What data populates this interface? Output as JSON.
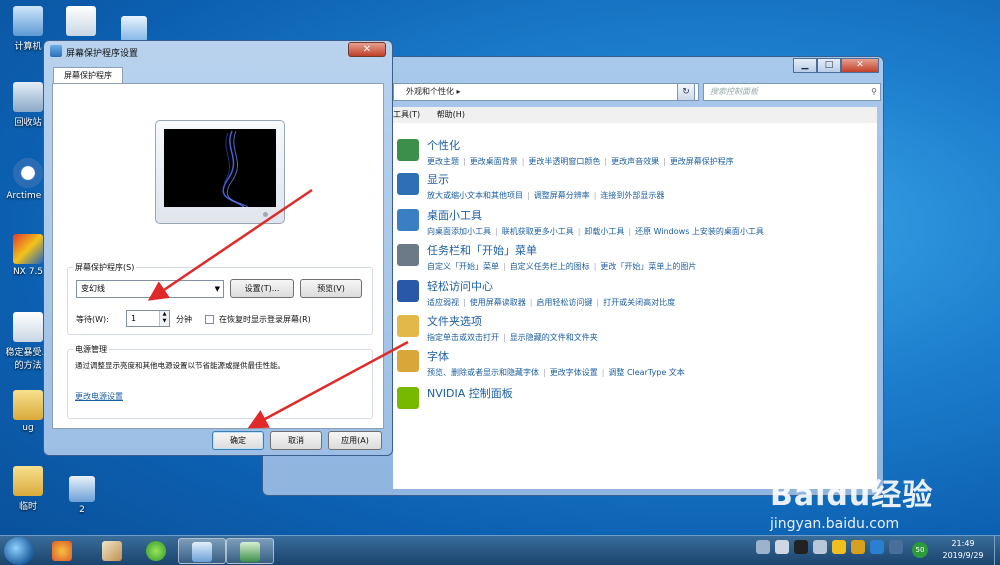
{
  "desktop": {
    "icons": [
      {
        "label": "计算机"
      },
      {
        "label": ""
      },
      {
        "label": ""
      },
      {
        "label": "回收站"
      },
      {
        "label": "Arctime P"
      },
      {
        "label": "NX 7.5"
      },
      {
        "label": "稳定暴受…的方法"
      },
      {
        "label": "ug"
      },
      {
        "label": "临时"
      },
      {
        "label": "2"
      }
    ]
  },
  "control_panel": {
    "address": "外观和个性化",
    "search_placeholder": "搜索控制面板",
    "menu": [
      "工具(T)",
      "帮助(H)"
    ],
    "categories": [
      {
        "title": "个性化",
        "links": [
          "更改主题",
          "更改桌面背景",
          "更改半透明窗口颜色",
          "更改声音效果",
          "更改屏幕保护程序"
        ],
        "icon_color": "#3b8f4a"
      },
      {
        "title": "显示",
        "links": [
          "放大或缩小文本和其他项目",
          "调整屏幕分辨率",
          "连接到外部显示器"
        ],
        "icon_color": "#2f6fb5"
      },
      {
        "title": "桌面小工具",
        "links": [
          "向桌面添加小工具",
          "联机获取更多小工具",
          "卸载小工具",
          "还原 Windows 上安装的桌面小工具"
        ],
        "icon_color": "#3a7fc4"
      },
      {
        "title": "任务栏和「开始」菜单",
        "links": [
          "自定义「开始」菜单",
          "自定义任务栏上的图标",
          "更改「开始」菜单上的图片"
        ],
        "icon_color": "#6c7a88"
      },
      {
        "title": "轻松访问中心",
        "links": [
          "适应弱视",
          "使用屏幕读取器",
          "启用轻松访问键",
          "打开或关闭高对比度"
        ],
        "icon_color": "#2a58a8"
      },
      {
        "title": "文件夹选项",
        "links": [
          "指定单击或双击打开",
          "显示隐藏的文件和文件夹"
        ],
        "icon_color": "#e2b84a"
      },
      {
        "title": "字体",
        "links": [
          "预览、删除或者显示和隐藏字体",
          "更改字体设置",
          "调整 ClearType 文本"
        ],
        "icon_color": "#d9a63a"
      },
      {
        "title": "NVIDIA 控制面板",
        "links": [],
        "icon_color": "#76b900"
      }
    ]
  },
  "dialog": {
    "title": "屏幕保护程序设置",
    "close": "✕",
    "tab": "屏幕保护程序",
    "ss_group_label": "屏幕保护程序(S)",
    "selected_saver": "变幻线",
    "settings_btn": "设置(T)...",
    "preview_btn": "预览(V)",
    "wait_label": "等待(W):",
    "wait_value": "1",
    "wait_unit": "分钟",
    "resume_checkbox": "在恢复时显示登录屏幕(R)",
    "power_group_label": "电源管理",
    "power_text": "通过调整显示亮度和其他电源设置以节省能源或提供最佳性能。",
    "power_link": "更改电源设置",
    "ok": "确定",
    "cancel": "取消",
    "apply": "应用(A)"
  },
  "taskbar": {
    "time": "21:49",
    "date": "2019/9/29",
    "tray_badge": "50"
  },
  "watermark": {
    "main": "Baidu经验",
    "sub": "jingyan.baidu.com"
  },
  "colors": {
    "link": "#1c5fa0",
    "arrow": "#e02a2a",
    "desktop": "#1d7fce"
  }
}
